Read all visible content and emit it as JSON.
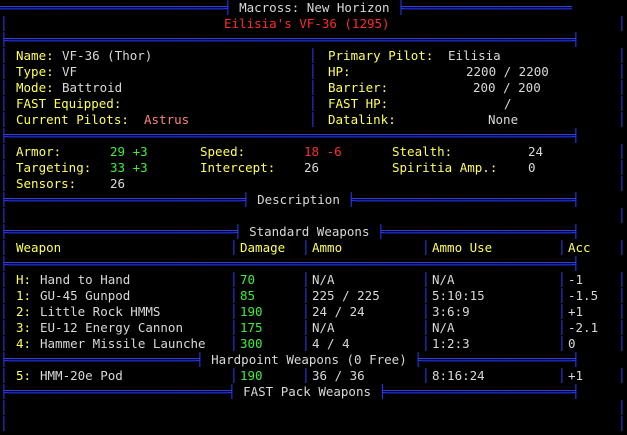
{
  "header": {
    "game_title": "Macross: New Horizon",
    "mech_title": "Eilisia's VF-36 (1295)"
  },
  "info": {
    "name_label": "Name:",
    "name_value": "VF-36 (Thor)",
    "type_label": "Type:",
    "type_value": "VF",
    "mode_label": "Mode:",
    "mode_value": "Battroid",
    "fast_label": "FAST Equipped:",
    "fast_value": "",
    "pilots_label": "Current Pilots:",
    "pilots_value": "Astrus",
    "primary_label": "Primary Pilot:",
    "primary_value": "Eilisia",
    "hp_label": "HP:",
    "hp_value": "2200 / 2200",
    "barrier_label": "Barrier:",
    "barrier_value": "200 / 200",
    "fasthp_label": "FAST HP:",
    "fasthp_value": "/",
    "datalink_label": "Datalink:",
    "datalink_value": "None"
  },
  "stats": {
    "armor_label": "Armor:",
    "armor_value": "29 +3",
    "speed_label": "Speed:",
    "speed_value": "18 -6",
    "stealth_label": "Stealth:",
    "stealth_value": "24",
    "targeting_label": "Targeting:",
    "targeting_value": "33 +3",
    "intercept_label": "Intercept:",
    "intercept_value": "26",
    "spiritia_label": "Spiritia Amp.:",
    "spiritia_value": "0",
    "sensors_label": "Sensors:",
    "sensors_value": "26"
  },
  "sections": {
    "description": "Description",
    "standard": "Standard Weapons",
    "hardpoint": "Hardpoint Weapons (0 Free)",
    "fastpack": "FAST Pack Weapons"
  },
  "weapons_header": {
    "weapon": "Weapon",
    "damage": "Damage",
    "ammo": "Ammo",
    "ammo_use": "Ammo Use",
    "acc": "Acc"
  },
  "standard_weapons": [
    {
      "key": "H:",
      "name": "Hand to Hand",
      "damage": "70",
      "ammo": "N/A",
      "ammo_use": "N/A",
      "acc": "-1"
    },
    {
      "key": "1:",
      "name": "GU-45 Gunpod",
      "damage": "85",
      "ammo": "225 / 225",
      "ammo_use": "5:10:15",
      "acc": "-1.5"
    },
    {
      "key": "2:",
      "name": "Little Rock HMMS",
      "damage": "190",
      "ammo": "24 / 24",
      "ammo_use": "3:6:9",
      "acc": "+1"
    },
    {
      "key": "3:",
      "name": "EU-12 Energy Cannon",
      "damage": "175",
      "ammo": "N/A",
      "ammo_use": "N/A",
      "acc": "-2.1"
    },
    {
      "key": "4:",
      "name": "Hammer Missile Launche",
      "damage": "300",
      "ammo": "4 / 4",
      "ammo_use": "1:2:3",
      "acc": "0"
    }
  ],
  "hardpoint_weapons": [
    {
      "key": "5:",
      "name": "HMM-20e Pod",
      "damage": "190",
      "ammo": "36 / 36",
      "ammo_use": "8:16:24",
      "acc": "+1"
    }
  ],
  "colors": {
    "border": "#2a3cff",
    "label": "#ffff55",
    "good": "#3cf03c",
    "bad": "#ff2a2a",
    "title": "#ff2a2a"
  }
}
